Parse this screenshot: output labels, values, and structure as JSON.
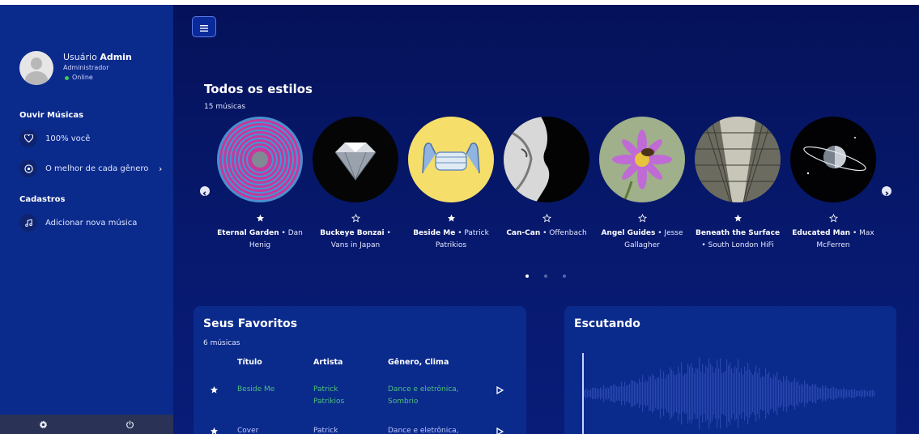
{
  "sidebar": {
    "user": {
      "greeting": "Usuário",
      "name": "Admin",
      "role": "Administrador",
      "status": "Online",
      "status_color": "#3ecb4e"
    },
    "sections": [
      {
        "title": "Ouvir Músicas",
        "items": [
          {
            "label": "100% você",
            "icon": "heart-icon"
          },
          {
            "label": "O melhor de cada gênero",
            "icon": "target-icon",
            "expand": "›"
          }
        ]
      },
      {
        "title": "Cadastros",
        "items": [
          {
            "label": "Adicionar nova música",
            "icon": "music-note-icon"
          }
        ]
      }
    ],
    "footer": [
      {
        "icon": "gear-icon"
      },
      {
        "icon": "power-icon"
      }
    ]
  },
  "main": {
    "hero": {
      "title": "Todos os estilos",
      "count": "15 músicas",
      "cards": [
        {
          "title": "Eternal Garden",
          "artist": "Dan Henig",
          "favorite": true,
          "cover": "spiral"
        },
        {
          "title": "Buckeye Bonzai",
          "artist": "Vans in Japan",
          "favorite": false,
          "cover": "diamond"
        },
        {
          "title": "Beside Me",
          "artist": "Patrick Patrikios",
          "favorite": true,
          "cover": "mask"
        },
        {
          "title": "Can-Can",
          "artist": "Offenbach",
          "favorite": false,
          "cover": "face"
        },
        {
          "title": "Angel Guides",
          "artist": "Jesse Gallagher",
          "favorite": false,
          "cover": "flower"
        },
        {
          "title": "Beneath the Surface",
          "artist": "South London HiFi",
          "favorite": true,
          "cover": "hall"
        },
        {
          "title": "Educated Man",
          "artist": "Max McFerren",
          "favorite": false,
          "cover": "planet"
        }
      ],
      "pages": 3,
      "active_page": 0
    },
    "favorites": {
      "title": "Seus Favoritos",
      "count": "6 músicas",
      "columns": [
        "Título",
        "Artista",
        "Gênero, Clima"
      ],
      "rows": [
        {
          "title": "Beside Me",
          "artist": "Patrick Patrikios",
          "genre": "Dance e eletrônica, Sombrio",
          "playing": true
        },
        {
          "title": "Cover",
          "artist": "Patrick",
          "genre": "Dance e eletrônica,",
          "playing": false
        }
      ]
    },
    "listening": {
      "title": "Escutando"
    }
  },
  "colors": {
    "sidebar": "#0a2a8c",
    "main_bg": "#05125a",
    "accent_green": "#4fc27a"
  }
}
